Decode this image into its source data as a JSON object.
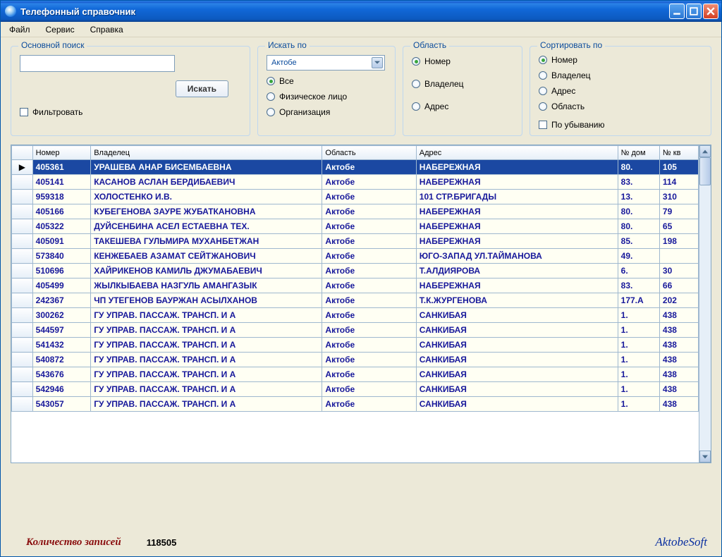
{
  "window": {
    "title": "Телефонный справочник"
  },
  "menubar": {
    "file": "Файл",
    "service": "Сервис",
    "help": "Справка"
  },
  "groups": {
    "main_search": {
      "legend": "Основной поиск",
      "search_btn": "Искать",
      "filter_label": "Фильтровать"
    },
    "search_by": {
      "legend": "Искать по",
      "dropdown_value": "Актобе",
      "opt_all": "Все",
      "opt_person": "Физическое лицо",
      "opt_org": "Организация"
    },
    "region": {
      "legend": "Область",
      "opt_number": "Номер",
      "opt_owner": "Владелец",
      "opt_address": "Адрес"
    },
    "sort": {
      "legend": "Сортировать по",
      "opt_number": "Номер",
      "opt_owner": "Владелец",
      "opt_address": "Адрес",
      "opt_region": "Область",
      "desc_label": "По убыванию"
    }
  },
  "grid": {
    "headers": {
      "number": "Номер",
      "owner": "Владелец",
      "region": "Область",
      "address": "Адрес",
      "house": "№ дом",
      "apt": "№ кв"
    },
    "rows": [
      {
        "num": "405361",
        "owner": "УРАШЕВА АНАР БИСЕМБАЕВНА",
        "region": "Актобе",
        "addr": "НАБЕРЕЖНАЯ",
        "house": "80.",
        "apt": "105",
        "selected": true
      },
      {
        "num": "405141",
        "owner": "КАСАНОВ АСЛАН БЕРДИБАЕВИЧ",
        "region": "Актобе",
        "addr": "НАБЕРЕЖНАЯ",
        "house": "83.",
        "apt": "114"
      },
      {
        "num": "959318",
        "owner": "ХОЛОСТЕНКО И.В.",
        "region": "Актобе",
        "addr": "101 СТР.БРИГАДЫ",
        "house": "13.",
        "apt": "310"
      },
      {
        "num": "405166",
        "owner": "КУБЕГЕНОВА ЗАУРЕ ЖУБАТКАНОВНА",
        "region": "Актобе",
        "addr": "НАБЕРЕЖНАЯ",
        "house": "80.",
        "apt": "79"
      },
      {
        "num": "405322",
        "owner": "ДУЙСЕНБИНА АСЕЛ ЕСТАЕВНА ТЕХ.",
        "region": "Актобе",
        "addr": "НАБЕРЕЖНАЯ",
        "house": "80.",
        "apt": "65"
      },
      {
        "num": "405091",
        "owner": "ТАКЕШЕВА ГУЛЬМИРА МУХАНБЕТЖАН",
        "region": "Актобе",
        "addr": "НАБЕРЕЖНАЯ",
        "house": "85.",
        "apt": "198"
      },
      {
        "num": "573840",
        "owner": "КЕНЖЕБАЕВ АЗАМАТ СЕЙТЖАНОВИЧ",
        "region": "Актобе",
        "addr": "ЮГО-ЗАПАД УЛ.ТАЙМАНОВА",
        "house": "49.",
        "apt": ""
      },
      {
        "num": "510696",
        "owner": "ХАЙРИКЕНОВ КАМИЛЬ ДЖУМАБАЕВИЧ",
        "region": "Актобе",
        "addr": "Т.АЛДИЯРОВА",
        "house": "6.",
        "apt": "30"
      },
      {
        "num": "405499",
        "owner": "ЖЫЛКЫБАЕВА НАЗГУЛЬ АМАНГАЗЫК",
        "region": "Актобе",
        "addr": "НАБЕРЕЖНАЯ",
        "house": "83.",
        "apt": "66"
      },
      {
        "num": "242367",
        "owner": "ЧП УТЕГЕНОВ БАУРЖАН АСЫЛХАНОВ",
        "region": "Актобе",
        "addr": "Т.К.ЖУРГЕНОВА",
        "house": "177.А",
        "apt": "202"
      },
      {
        "num": "300262",
        "owner": "ГУ  УПРАВ. ПАССАЖ. ТРАНСП. И А",
        "region": "Актобе",
        "addr": "САНКИБАЯ",
        "house": "1.",
        "apt": "438"
      },
      {
        "num": "544597",
        "owner": "ГУ  УПРАВ. ПАССАЖ. ТРАНСП. И А",
        "region": "Актобе",
        "addr": "САНКИБАЯ",
        "house": "1.",
        "apt": "438"
      },
      {
        "num": "541432",
        "owner": "ГУ  УПРАВ. ПАССАЖ. ТРАНСП. И А",
        "region": "Актобе",
        "addr": "САНКИБАЯ",
        "house": "1.",
        "apt": "438"
      },
      {
        "num": "540872",
        "owner": "ГУ  УПРАВ. ПАССАЖ. ТРАНСП. И А",
        "region": "Актобе",
        "addr": "САНКИБАЯ",
        "house": "1.",
        "apt": "438"
      },
      {
        "num": "543676",
        "owner": "ГУ  УПРАВ. ПАССАЖ. ТРАНСП. И А",
        "region": "Актобе",
        "addr": "САНКИБАЯ",
        "house": "1.",
        "apt": "438"
      },
      {
        "num": "542946",
        "owner": "ГУ  УПРАВ. ПАССАЖ. ТРАНСП. И А",
        "region": "Актобе",
        "addr": "САНКИБАЯ",
        "house": "1.",
        "apt": "438"
      },
      {
        "num": "543057",
        "owner": "ГУ  УПРАВ. ПАССАЖ. ТРАНСП. И А",
        "region": "Актобе",
        "addr": "САНКИБАЯ",
        "house": "1.",
        "apt": "438"
      }
    ]
  },
  "footer": {
    "count_label": "Количество записей",
    "count_value": "118505",
    "brand": "AktobeSoft"
  }
}
